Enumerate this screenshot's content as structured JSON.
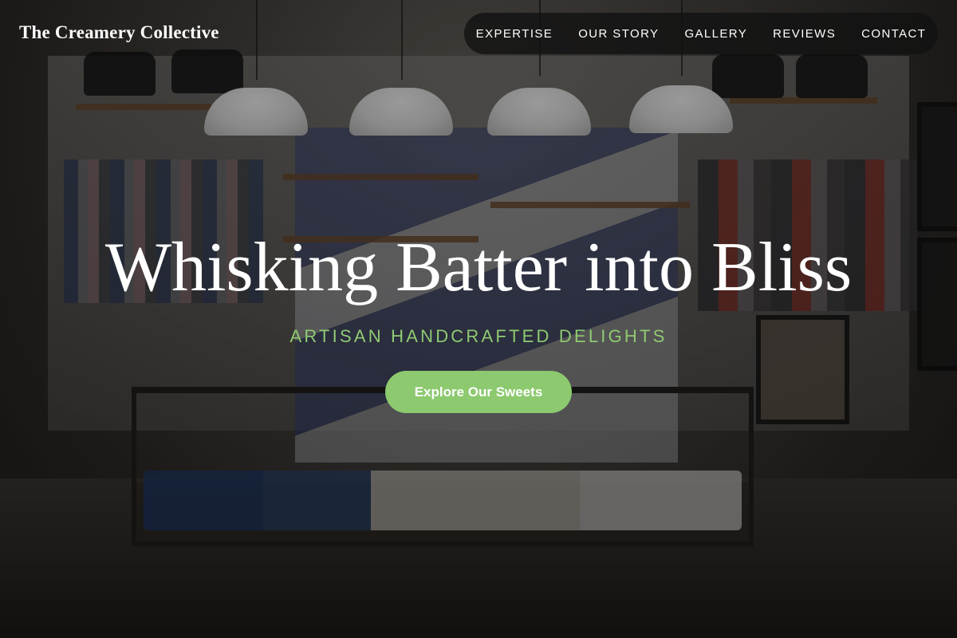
{
  "header": {
    "brand": "The Creamery Collective"
  },
  "nav": {
    "items": [
      {
        "label": "EXPERTISE"
      },
      {
        "label": "OUR STORY"
      },
      {
        "label": "GALLERY"
      },
      {
        "label": "REVIEWS"
      },
      {
        "label": "CONTACT"
      }
    ]
  },
  "hero": {
    "headline": "Whisking Batter into Bliss",
    "tagline": "ARTISAN HANDCRAFTED DELIGHTS",
    "cta_label": "Explore Our Sweets"
  },
  "colors": {
    "accent": "#8cc96f",
    "tagline": "#8fca72",
    "nav_bg": "#121212",
    "text": "#ffffff"
  }
}
